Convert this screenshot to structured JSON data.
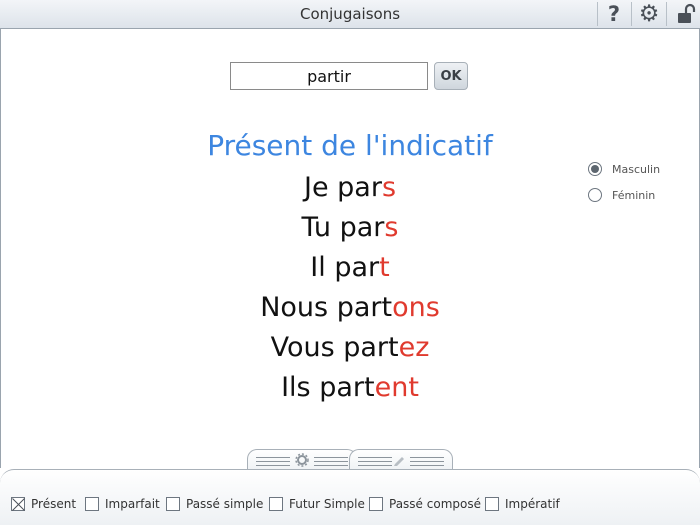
{
  "app": {
    "title": "Conjugaisons"
  },
  "verb": {
    "value": "partir",
    "ok_label": "OK"
  },
  "tense_title": "Présent de l'indicatif",
  "conjugations": [
    {
      "stem": "Je par",
      "ending": "s"
    },
    {
      "stem": "Tu par",
      "ending": "s"
    },
    {
      "stem": "Il par",
      "ending": "t"
    },
    {
      "stem": "Nous part",
      "ending": "ons"
    },
    {
      "stem": "Vous part",
      "ending": "ez"
    },
    {
      "stem": "Ils part",
      "ending": "ent"
    }
  ],
  "gender": {
    "options": [
      "Masculin",
      "Féminin"
    ],
    "selected": "Masculin"
  },
  "tenses": [
    {
      "label": "Présent",
      "checked": true
    },
    {
      "label": "Imparfait",
      "checked": false
    },
    {
      "label": "Passé simple",
      "checked": false
    },
    {
      "label": "Futur Simple",
      "checked": false
    },
    {
      "label": "Passé composé",
      "checked": false
    },
    {
      "label": "Impératif",
      "checked": false
    }
  ],
  "icons": {
    "help": "help-icon",
    "settings": "gear-icon",
    "lock": "lock-open-icon",
    "tab1": "gear-icon",
    "tab2": "pencil-icon"
  },
  "colors": {
    "tense_title": "#3d86e0",
    "ending": "#e03a2e"
  }
}
